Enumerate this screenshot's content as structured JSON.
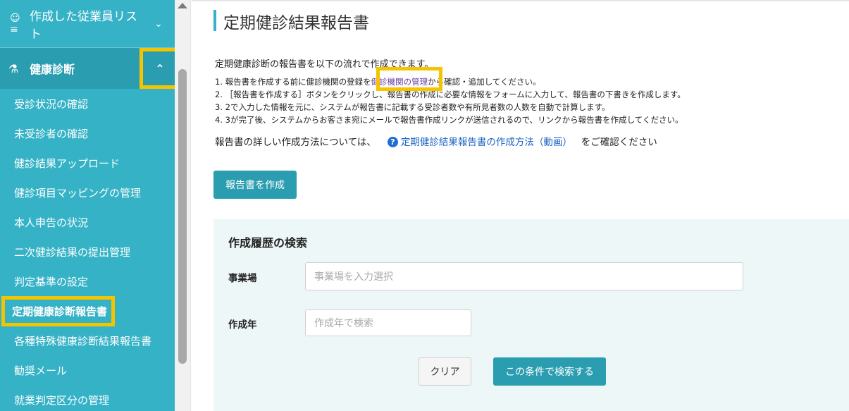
{
  "sidebar": {
    "header_label": "作成した従業員リスト",
    "section_label": "健康診断",
    "items": [
      {
        "label": "受診状況の確認"
      },
      {
        "label": "未受診者の確認"
      },
      {
        "label": "健診結果アップロード"
      },
      {
        "label": "健診項目マッピングの管理"
      },
      {
        "label": "本人申告の状況"
      },
      {
        "label": "二次健診結果の提出管理"
      },
      {
        "label": "判定基準の設定"
      },
      {
        "label": "定期健康診断報告書"
      },
      {
        "label": "各種特殊健康診断結果報告書"
      },
      {
        "label": "勧奨メール"
      },
      {
        "label": "就業判定区分の管理"
      }
    ]
  },
  "main": {
    "title": "定期健診結果報告書",
    "intro": "定期健康診断の報告書を以下の流れで作成できます。",
    "step1_pre": "1. 報告書を作成する前に健診機関の登録を",
    "step1_link": "健診機関の管理",
    "step1_post": "から確認・追加してください。",
    "step2": "2. ［報告書を作成する］ボタンをクリックし、報告書の作成に必要な情報をフォームに入力して、報告書の下書きを作成します。",
    "step3": "3. 2で入力した情報を元に、システムが報告書に記載する受診者数や有所見者数の人数を自動で計算します。",
    "step4": "4. 3が完了後、システムからお客さま宛にメールで報告書作成リンクが送信されるので、リンクから報告書を作成してください。",
    "howto_pre": "報告書の詳しい作成方法については、",
    "howto_link": "定期健診結果報告書の作成方法（動画）",
    "howto_post": "をご確認ください",
    "create_button": "報告書を作成"
  },
  "search": {
    "title": "作成履歴の検索",
    "office_label": "事業場",
    "office_placeholder": "事業場を入力選択",
    "year_label": "作成年",
    "year_placeholder": "作成年で検索",
    "clear_button": "クリア",
    "search_button": "この条件で検索する"
  },
  "colors": {
    "sidebar_bg": "#35b2c6",
    "accent": "#2a9db0",
    "highlight": "#f5c400"
  }
}
